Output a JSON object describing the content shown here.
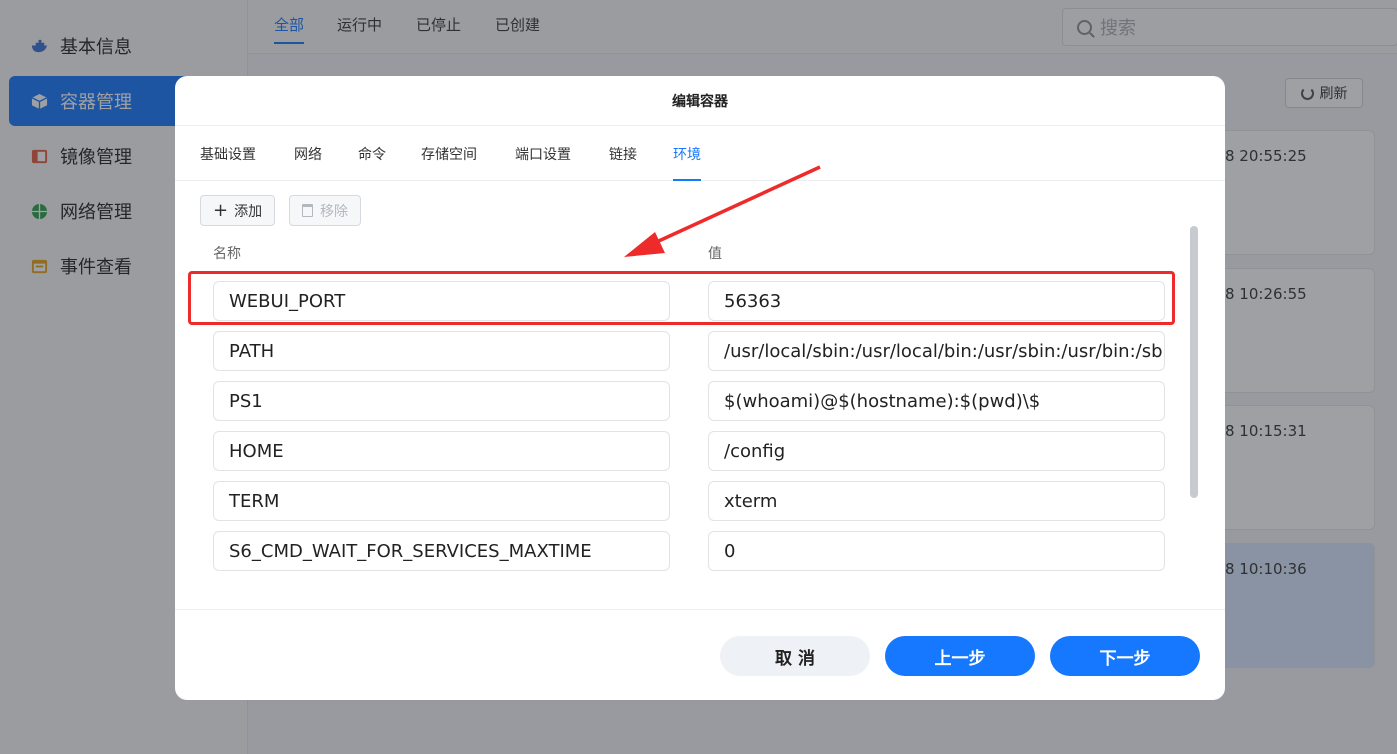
{
  "sidebar": {
    "items": [
      {
        "label": "基本信息",
        "icon": "docker-whale-icon",
        "color": "#3a6fd8",
        "active": false
      },
      {
        "label": "容器管理",
        "icon": "cube-icon",
        "color": "#ffffff",
        "active": true
      },
      {
        "label": "镜像管理",
        "icon": "image-layers-icon",
        "color": "#e45a3b",
        "active": false
      },
      {
        "label": "网络管理",
        "icon": "globe-icon",
        "color": "#2e9d4e",
        "active": false
      },
      {
        "label": "事件查看",
        "icon": "event-calendar-icon",
        "color": "#e8a317",
        "active": false
      }
    ]
  },
  "topbar": {
    "tabs": [
      {
        "label": "全部",
        "active": true
      },
      {
        "label": "运行中",
        "active": false
      },
      {
        "label": "已停止",
        "active": false
      },
      {
        "label": "已创建",
        "active": false
      }
    ],
    "search_placeholder": "搜索"
  },
  "main": {
    "refresh_label": "刷新",
    "cards": [
      {
        "time": "8 20:55:25"
      },
      {
        "time": "8 10:26:55"
      },
      {
        "time": "8 10:15:31"
      },
      {
        "time": "8 10:10:36"
      }
    ]
  },
  "modal": {
    "title": "编辑容器",
    "tabs": [
      {
        "label": "基础设置"
      },
      {
        "label": "网络"
      },
      {
        "label": "命令"
      },
      {
        "label": "存储空间"
      },
      {
        "label": "端口设置"
      },
      {
        "label": "链接"
      },
      {
        "label": "环境"
      }
    ],
    "active_tab": "环境",
    "add_label": "添加",
    "remove_label": "移除",
    "col_name": "名称",
    "col_value": "值",
    "env_rows": [
      {
        "name": "WEBUI_PORT",
        "value": "56363"
      },
      {
        "name": "PATH",
        "value": "/usr/local/sbin:/usr/local/bin:/usr/sbin:/usr/bin:/sbin:/bin"
      },
      {
        "name": "PS1",
        "value": "$(whoami)@$(hostname):$(pwd)\\$"
      },
      {
        "name": "HOME",
        "value": "/config"
      },
      {
        "name": "TERM",
        "value": "xterm"
      },
      {
        "name": "S6_CMD_WAIT_FOR_SERVICES_MAXTIME",
        "value": "0"
      }
    ],
    "cancel_label": "取 消",
    "prev_label": "上一步",
    "next_label": "下一步"
  },
  "annotation": {
    "color": "#ee2b2b"
  }
}
